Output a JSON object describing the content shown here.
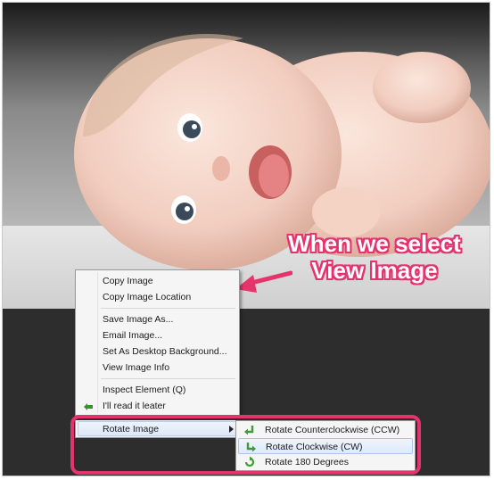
{
  "annotation": {
    "line1": "When we select",
    "line2": "View Image"
  },
  "context_menu": {
    "items": [
      {
        "label": "Copy Image"
      },
      {
        "label": "Copy Image Location"
      },
      {
        "label": "Save Image As..."
      },
      {
        "label": "Email Image..."
      },
      {
        "label": "Set As Desktop Background..."
      },
      {
        "label": "View Image Info"
      },
      {
        "label": "Inspect Element (Q)"
      },
      {
        "label": "I'll read it leater"
      }
    ],
    "rotate_label": "Rotate Image"
  },
  "submenu": {
    "items": [
      {
        "label": "Rotate Counterclockwise (CCW)",
        "icon": "rotate-ccw-icon"
      },
      {
        "label": "Rotate Clockwise (CW)",
        "icon": "rotate-cw-icon"
      },
      {
        "label": "Rotate 180 Degrees",
        "icon": "rotate-180-icon"
      }
    ]
  },
  "colors": {
    "accent": "#e5336e",
    "menu_bg": "#f5f5f5",
    "dark_bg": "#2d2d2d"
  }
}
